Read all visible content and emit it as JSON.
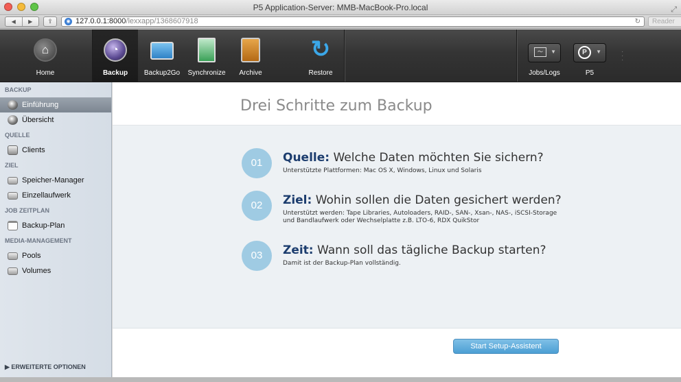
{
  "window": {
    "title": "P5 Application-Server: MMB-MacBook-Pro.local"
  },
  "browser": {
    "url_host": "127.0.0.1:8000",
    "url_path": "/lexxapp/1368607918",
    "reader_label": "Reader"
  },
  "nav": {
    "home": "Home",
    "backup": "Backup",
    "backup2go": "Backup2Go",
    "synchronize": "Synchronize",
    "archive": "Archive",
    "restore": "Restore",
    "jobs": "Jobs/Logs",
    "p5": "P5"
  },
  "sidebar": {
    "sec_backup": "BACKUP",
    "item_intro": "Einführung",
    "item_overview": "Übersicht",
    "sec_source": "QUELLE",
    "item_clients": "Clients",
    "sec_target": "ZIEL",
    "item_storage": "Speicher-Manager",
    "item_single": "Einzellaufwerk",
    "sec_schedule": "JOB ZEITPLAN",
    "item_plan": "Backup-Plan",
    "sec_media": "MEDIA-MANAGEMENT",
    "item_pools": "Pools",
    "item_volumes": "Volumes",
    "advanced": "ERWEITERTE OPTIONEN"
  },
  "main": {
    "title": "Drei Schritte zum Backup",
    "steps": [
      {
        "num": "01",
        "key": "Quelle:",
        "title": "Welche Daten möchten Sie sichern?",
        "desc": "Unterstützte Plattformen: Mac OS X, Windows, Linux und Solaris"
      },
      {
        "num": "02",
        "key": "Ziel:",
        "title": "Wohin sollen die Daten gesichert werden?",
        "desc": "Unterstützt werden: Tape Libraries, Autoloaders, RAID-, SAN-, Xsan-, NAS-, iSCSI-Storage und Bandlaufwerk oder Wechselplatte z.B. LTO-6, RDX QuikStor"
      },
      {
        "num": "03",
        "key": "Zeit:",
        "title": "Wann soll das tägliche Backup starten?",
        "desc": "Damit ist der Backup-Plan vollständig."
      }
    ],
    "start_button": "Start Setup-Assistent"
  },
  "colors": {
    "accent": "#4c9fd4",
    "step_circle": "#9fcbe3",
    "nav_bg": "#343434",
    "sidebar_bg": "#dfe5ec"
  }
}
